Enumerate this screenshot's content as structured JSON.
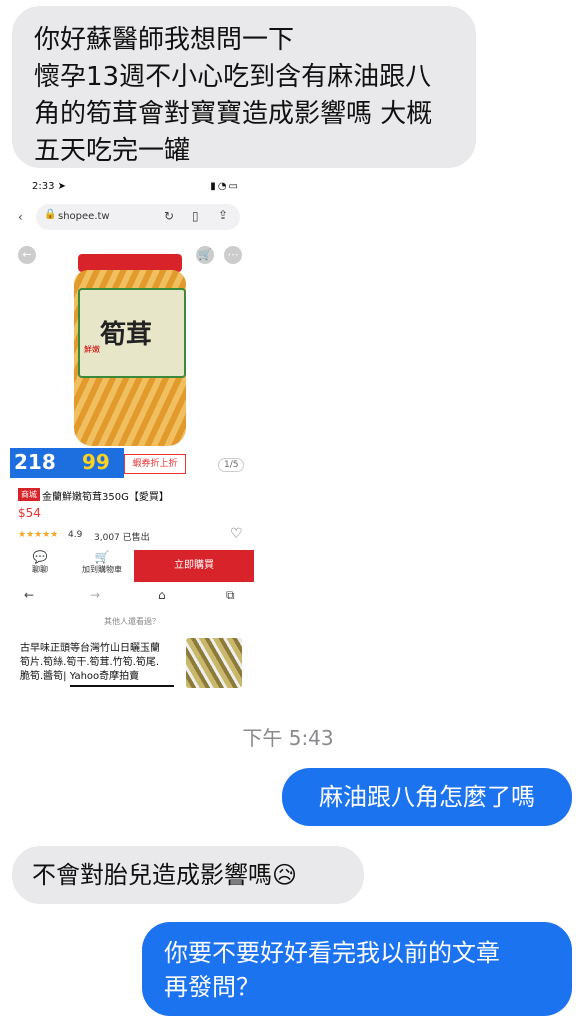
{
  "messages": {
    "m1": "你好蘇醫師我想問一下\n懷孕13週不小心吃到含有麻油跟八\n角的筍茸會對寶寶造成影響嗎 大概\n五天吃完一罐",
    "timestamp": "下午 5:43",
    "m2": "麻油跟八角怎麼了嗎",
    "m3": "不會對胎兒造成影響嗎",
    "m3_emoji": "😥",
    "m4": "你要不要好好看完我以前的文章\n再發問？"
  },
  "screenshot": {
    "time": "2:33",
    "url": "shopee.tw",
    "promo_number": "218",
    "promo_price": "99",
    "promo_tag": "蝦券折上折",
    "pager": "1/5",
    "badge": "商城",
    "jar_label": "筍茸",
    "jar_small": "鮮嫩",
    "product_title": "金蘭鮮嫩筍茸350G【愛買】",
    "price": "$54",
    "stars": "★★★★★",
    "rating": "4.9",
    "sold": "3,007 已售出",
    "chat_label": "聊聊",
    "cart_label": "加到購物車",
    "buy_label": "立即購買",
    "others_label": "其他人還看過？",
    "link_text": "古早味正頭等台灣竹山日曬玉蘭\n筍片.筍絲.筍干.筍茸.竹筍.筍尾.\n脆筍.醬筍| Yahoo奇摩拍賣"
  },
  "icons": [
    "location-arrow-icon",
    "signal-icon",
    "wifi-icon",
    "battery-icon",
    "back-icon",
    "lock-icon",
    "reload-icon",
    "bookmark-icon",
    "share-icon",
    "cart-icon",
    "more-icon",
    "chat-icon",
    "heart-icon",
    "forward-icon",
    "home-icon",
    "tabs-icon"
  ]
}
